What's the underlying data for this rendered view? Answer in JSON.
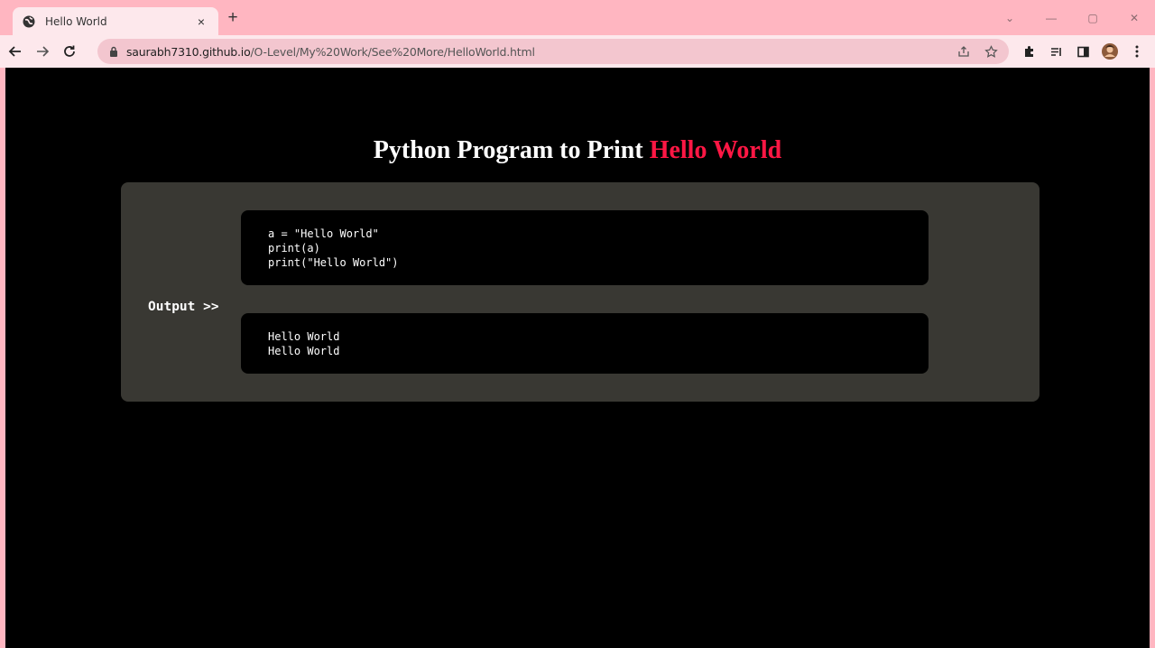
{
  "browser": {
    "tab_title": "Hello World",
    "tab_close": "×",
    "new_tab": "+",
    "url_host": "saurabh7310.github.io",
    "url_path": "/O-Level/My%20Work/See%20More/HelloWorld.html",
    "window_controls": {
      "minimize": "—",
      "restore": "▢",
      "close": "✕",
      "tab_search": "⌄"
    }
  },
  "page": {
    "title_prefix": "Python Program to Print ",
    "title_accent": "Hello World",
    "code_lines": [
      "a = \"Hello World\"",
      "print(a)",
      "print(\"Hello World\")"
    ],
    "output_label": "Output >>",
    "output_lines": [
      "Hello World",
      "Hello World"
    ]
  },
  "colors": {
    "chrome_tabstrip": "#ffb6c1",
    "chrome_toolbar": "#fde8ec",
    "page_background": "#000000",
    "panel_background": "#393833",
    "title_accent": "#ff1744"
  }
}
